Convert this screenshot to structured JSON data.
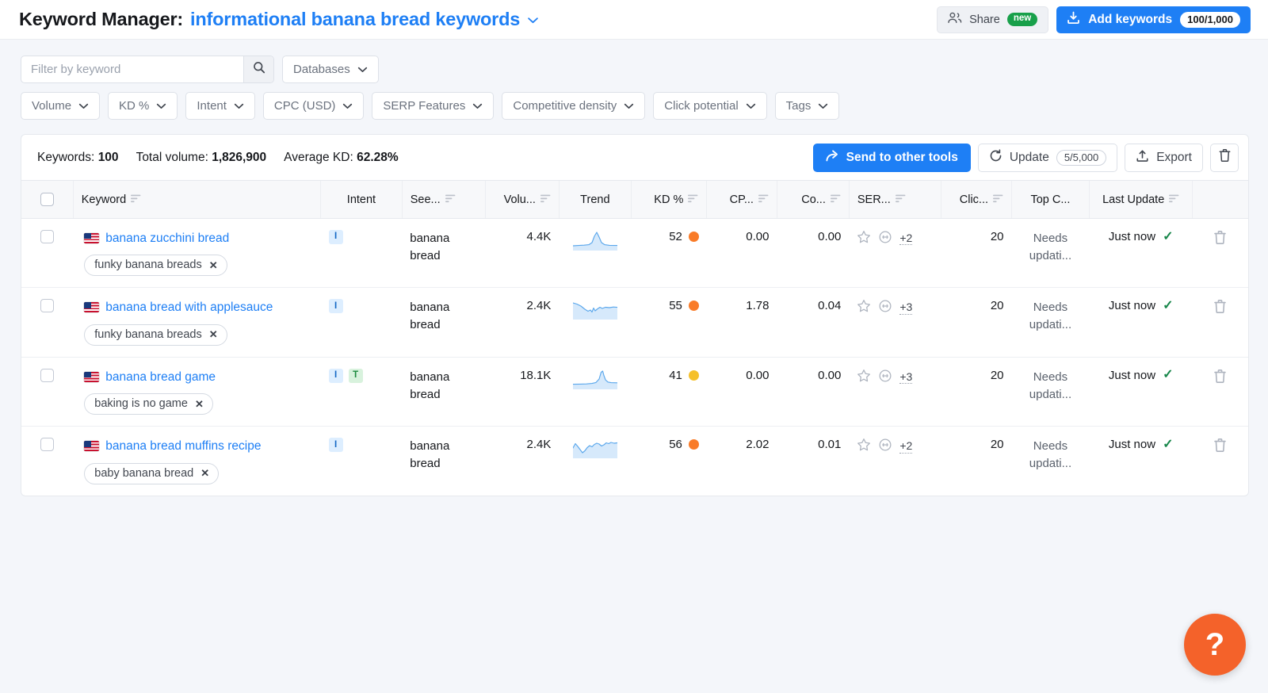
{
  "header": {
    "title_prefix": "Keyword Manager:",
    "list_name": "informational banana bread keywords",
    "share_label": "Share",
    "share_badge": "new",
    "add_label": "Add keywords",
    "add_count": "100/1,000"
  },
  "filters": {
    "search_placeholder": "Filter by keyword",
    "search_value": "",
    "databases_label": "Databases",
    "pills": [
      {
        "label": "Volume"
      },
      {
        "label": "KD %"
      },
      {
        "label": "Intent"
      },
      {
        "label": "CPC (USD)"
      },
      {
        "label": "SERP Features"
      },
      {
        "label": "Competitive density"
      },
      {
        "label": "Click potential"
      },
      {
        "label": "Tags"
      }
    ]
  },
  "toolbar": {
    "keywords_label": "Keywords:",
    "keywords_value": "100",
    "total_volume_label": "Total volume:",
    "total_volume_value": "1,826,900",
    "average_kd_label": "Average KD:",
    "average_kd_value": "62.28%",
    "send_label": "Send to other tools",
    "update_label": "Update",
    "update_count": "5/5,000",
    "export_label": "Export",
    "delete_title": "Delete"
  },
  "table": {
    "columns": [
      {
        "label": "Keyword",
        "sortable": true,
        "align": "left",
        "sorted": false
      },
      {
        "label": "Intent",
        "sortable": false,
        "align": "center",
        "sorted": false
      },
      {
        "label": "See...",
        "sortable": true,
        "align": "left",
        "sorted": false
      },
      {
        "label": "Volu...",
        "sortable": true,
        "align": "right",
        "sorted": false
      },
      {
        "label": "Trend",
        "sortable": false,
        "align": "center",
        "sorted": false
      },
      {
        "label": "KD %",
        "sortable": true,
        "align": "right",
        "sorted": false
      },
      {
        "label": "CP...",
        "sortable": true,
        "align": "right",
        "sorted": false
      },
      {
        "label": "Co...",
        "sortable": true,
        "align": "right",
        "sorted": false
      },
      {
        "label": "SER...",
        "sortable": true,
        "align": "left",
        "sorted": false
      },
      {
        "label": "Clic...",
        "sortable": true,
        "align": "right",
        "sorted": false
      },
      {
        "label": "Top C...",
        "sortable": false,
        "align": "center",
        "sorted": false
      },
      {
        "label": "Last Update",
        "sortable": true,
        "align": "center",
        "sorted": true
      }
    ],
    "rows": [
      {
        "keyword": "banana zucchini bread",
        "flag": "us-flag",
        "tag": "funky banana breads",
        "intents": [
          "I"
        ],
        "seed": "banana bread",
        "volume": "4.4K",
        "trend": "spike-center",
        "kd": "52",
        "kd_color": "#f97b28",
        "cpc": "0.00",
        "competitive_density": "0.00",
        "serp_more": "+2",
        "click_potential": "20",
        "top_competitor": "Needs updati...",
        "last_update": "Just now"
      },
      {
        "keyword": "banana bread with applesauce",
        "flag": "us-flag",
        "tag": "funky banana breads",
        "intents": [
          "I"
        ],
        "seed": "banana bread",
        "volume": "2.4K",
        "trend": "declining-wavy",
        "kd": "55",
        "kd_color": "#f97b28",
        "cpc": "1.78",
        "competitive_density": "0.04",
        "serp_more": "+3",
        "click_potential": "20",
        "top_competitor": "Needs updati...",
        "last_update": "Just now"
      },
      {
        "keyword": "banana bread game",
        "flag": "us-flag",
        "tag": "baking is no game",
        "intents": [
          "I",
          "T"
        ],
        "seed": "banana bread",
        "volume": "18.1K",
        "trend": "spike-right",
        "kd": "41",
        "kd_color": "#f5c02b",
        "cpc": "0.00",
        "competitive_density": "0.00",
        "serp_more": "+3",
        "click_potential": "20",
        "top_competitor": "Needs updati...",
        "last_update": "Just now"
      },
      {
        "keyword": "banana bread muffins recipe",
        "flag": "us-flag",
        "tag": "baby banana bread",
        "intents": [
          "I"
        ],
        "seed": "banana bread",
        "volume": "2.4K",
        "trend": "rising-wavy",
        "kd": "56",
        "kd_color": "#f97b28",
        "cpc": "2.02",
        "competitive_density": "0.01",
        "serp_more": "+2",
        "click_potential": "20",
        "top_competitor": "Needs updati...",
        "last_update": "Just now"
      }
    ]
  },
  "help": {
    "label": "?"
  },
  "colors": {
    "accent_blue": "#1e7ff5",
    "kd_orange": "#f97b28",
    "kd_yellow": "#f5c02b",
    "green_check": "#17864a",
    "help_orange": "#f4622a",
    "badge_green": "#18a04a"
  }
}
